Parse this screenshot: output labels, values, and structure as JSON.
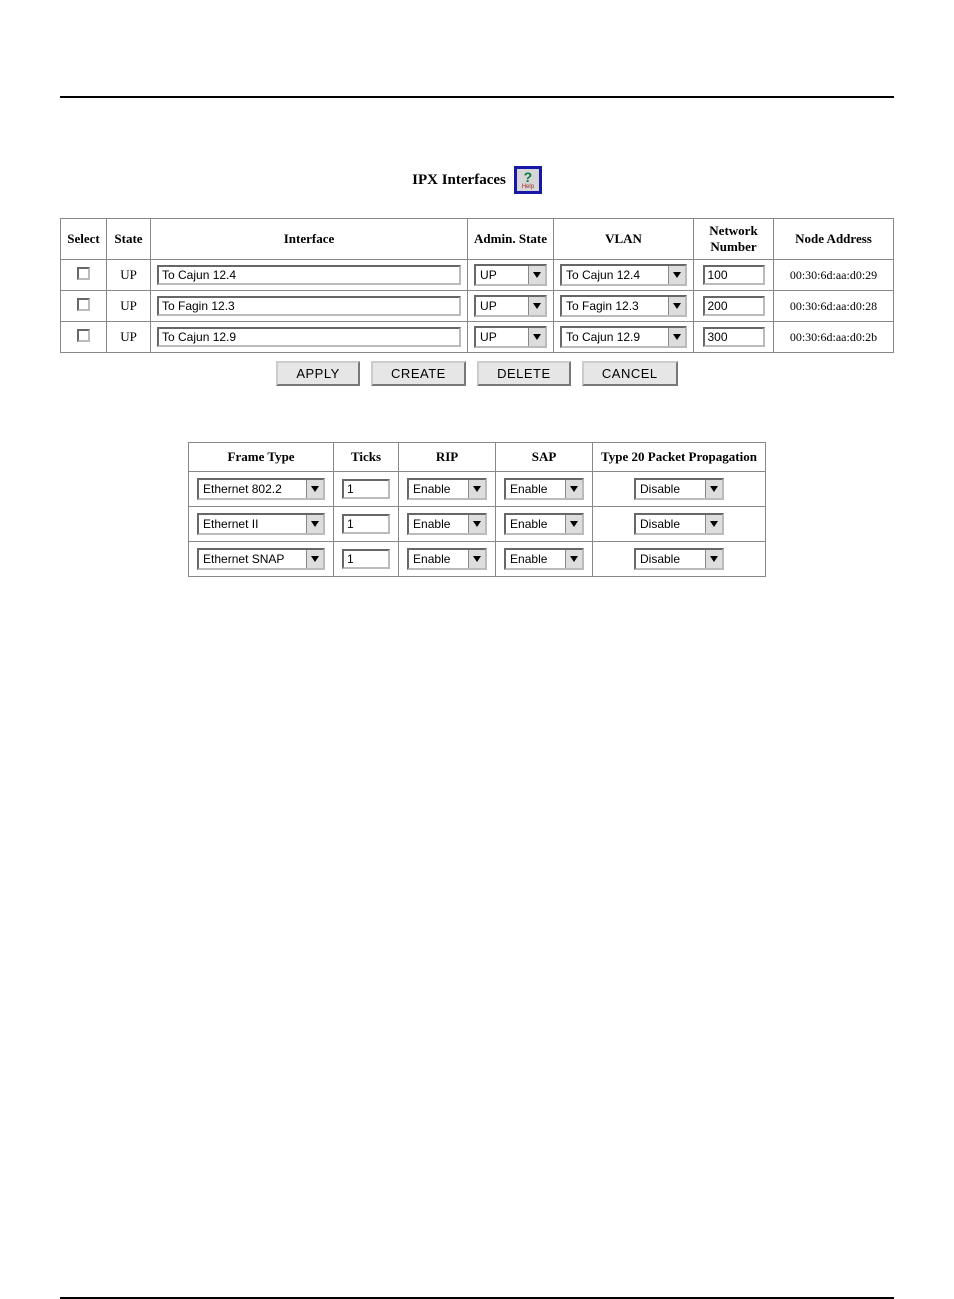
{
  "title": "IPX Interfaces",
  "help": {
    "icon_label": "Help",
    "q": "?"
  },
  "table1": {
    "headers": {
      "select": "Select",
      "state": "State",
      "interface": "Interface",
      "admin": "Admin. State",
      "vlan": "VLAN",
      "netnum_l1": "Network",
      "netnum_l2": "Number",
      "node": "Node Address"
    },
    "rows": [
      {
        "state": "UP",
        "interface": "To Cajun 12.4",
        "admin": "UP",
        "vlan": "To Cajun 12.4",
        "netnum": "100",
        "node": "00:30:6d:aa:d0:29"
      },
      {
        "state": "UP",
        "interface": "To Fagin 12.3",
        "admin": "UP",
        "vlan": "To Fagin 12.3",
        "netnum": "200",
        "node": "00:30:6d:aa:d0:28"
      },
      {
        "state": "UP",
        "interface": "To Cajun 12.9",
        "admin": "UP",
        "vlan": "To Cajun 12.9",
        "netnum": "300",
        "node": "00:30:6d:aa:d0:2b"
      }
    ]
  },
  "buttons": {
    "apply": "APPLY",
    "create": "CREATE",
    "delete": "DELETE",
    "cancel": "CANCEL"
  },
  "table2": {
    "headers": {
      "frame": "Frame Type",
      "ticks": "Ticks",
      "rip": "RIP",
      "sap": "SAP",
      "t20_l1": "Type 20 Packet",
      "t20_l2": "Propagation"
    },
    "rows": [
      {
        "frame": "Ethernet 802.2",
        "ticks": "1",
        "rip": "Enable",
        "sap": "Enable",
        "t20": "Disable"
      },
      {
        "frame": "Ethernet II",
        "ticks": "1",
        "rip": "Enable",
        "sap": "Enable",
        "t20": "Disable"
      },
      {
        "frame": "Ethernet SNAP",
        "ticks": "1",
        "rip": "Enable",
        "sap": "Enable",
        "t20": "Disable"
      }
    ]
  }
}
